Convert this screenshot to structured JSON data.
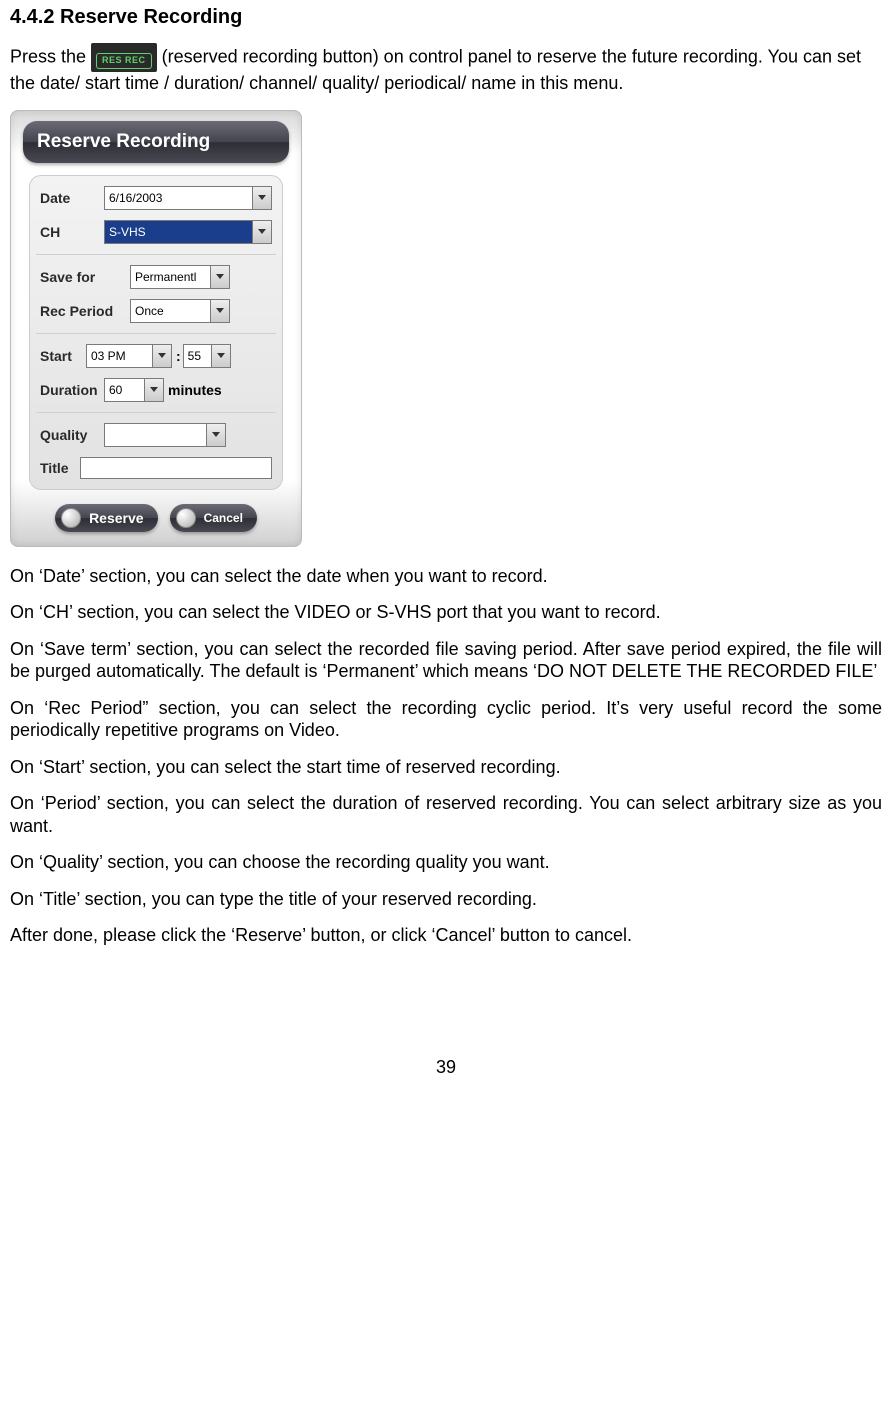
{
  "heading": "4.4.2   Reserve Recording",
  "intro": {
    "before_badge": "Press the ",
    "badge": "RES REC",
    "after_badge": " (reserved recording button) on control panel to reserve the future recording. You can set the date/ start time / duration/ channel/ quality/ periodical/ name in this menu."
  },
  "dialog": {
    "title": "Reserve Recording",
    "labels": {
      "date": "Date",
      "ch": "CH",
      "save_for": "Save for",
      "rec_period": "Rec Period",
      "start": "Start",
      "duration": "Duration",
      "quality": "Quality",
      "title_label": "Title"
    },
    "values": {
      "date": "6/16/2003",
      "ch": "S-VHS",
      "save_for": "Permanentl",
      "rec_period": "Once",
      "start_hour": "03 PM",
      "start_min_prefix": ": ",
      "start_min": "55",
      "duration": "60",
      "duration_unit": "minutes",
      "quality": "",
      "title_value": ""
    },
    "buttons": {
      "reserve": "Reserve",
      "cancel": "Cancel"
    }
  },
  "paragraphs": {
    "p1": "On ‘Date’ section, you can select the date when you want to record.",
    "p2": "On ‘CH’ section, you can select the VIDEO or S-VHS port that you want to record.",
    "p3": "On ‘Save term’ section, you can select the recorded file saving period. After save period expired, the file will be purged automatically. The default is ‘Permanent’ which means ‘DO NOT DELETE THE RECORDED FILE’",
    "p4": "On ‘Rec Period” section, you can select the recording cyclic period. It’s very useful record the some periodically repetitive programs on Video.",
    "p5": "On ‘Start’ section, you can select the start time of reserved recording.",
    "p6": "On ‘Period’ section, you can select the duration of reserved recording. You can select arbitrary size as you want.",
    "p7": "On ‘Quality’ section, you can choose the recording quality you want.",
    "p8": "On ‘Title’ section, you can type the title of your reserved recording.",
    "p9": "After done, please click the ‘Reserve’ button, or click ‘Cancel’ button to cancel."
  },
  "page_number": "39"
}
